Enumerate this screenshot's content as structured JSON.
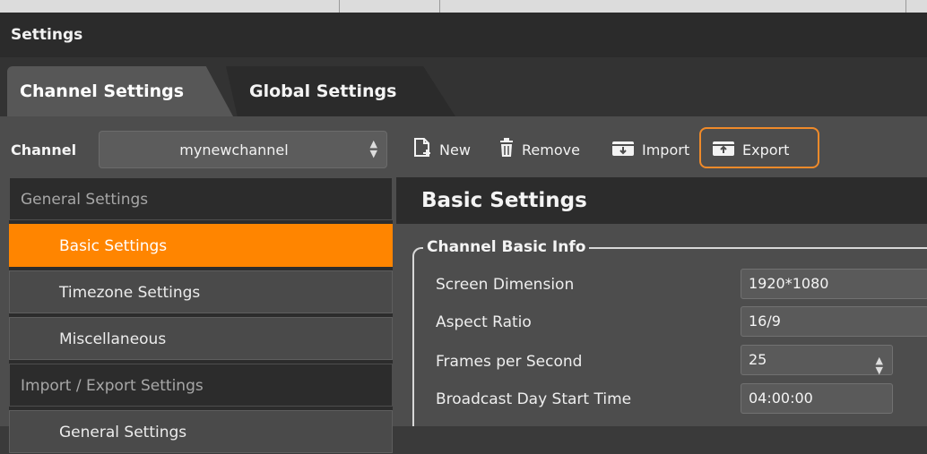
{
  "window": {
    "title": "Settings"
  },
  "tabs": [
    {
      "label": "Channel Settings",
      "active": true
    },
    {
      "label": "Global Settings",
      "active": false
    }
  ],
  "channel": {
    "label": "Channel",
    "value": "mynewchannel"
  },
  "toolbar": {
    "new_label": "New",
    "remove_label": "Remove",
    "import_label": "Import",
    "export_label": "Export",
    "highlight_color": "#ef8a2a"
  },
  "nav": {
    "items": [
      {
        "label": "General Settings",
        "type": "group"
      },
      {
        "label": "Basic Settings",
        "type": "item",
        "active": true
      },
      {
        "label": "Timezone Settings",
        "type": "item"
      },
      {
        "label": "Miscellaneous",
        "type": "item"
      },
      {
        "label": "Import / Export Settings",
        "type": "group"
      },
      {
        "label": "General Settings",
        "type": "item"
      }
    ],
    "active_color": "#ff8500"
  },
  "main": {
    "header": "Basic Settings",
    "group_title": "Channel Basic Info",
    "fields": [
      {
        "label": "Screen Dimension",
        "value": "1920*1080"
      },
      {
        "label": "Aspect Ratio",
        "value": "16/9"
      },
      {
        "label": "Frames per Second",
        "value": "25"
      },
      {
        "label": "Broadcast Day Start Time",
        "value": "04:00:00"
      }
    ]
  },
  "icons": {
    "new": "new-file-icon",
    "remove": "trash-icon",
    "import": "import-icon",
    "export": "export-icon"
  }
}
